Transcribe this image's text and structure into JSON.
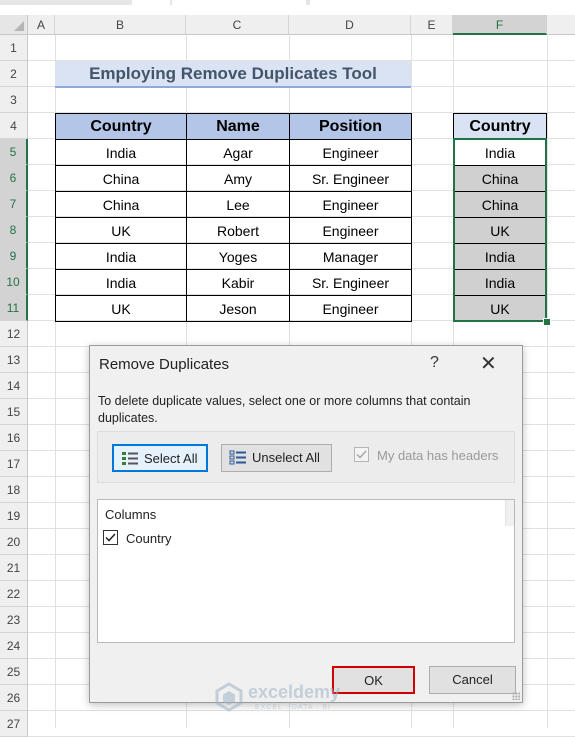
{
  "columns": [
    "A",
    "B",
    "C",
    "D",
    "E",
    "F"
  ],
  "rows": [
    "1",
    "2",
    "3",
    "4",
    "5",
    "6",
    "7",
    "8",
    "9",
    "10",
    "11",
    "12",
    "13",
    "14",
    "15",
    "16",
    "17",
    "18",
    "19",
    "20",
    "21",
    "22",
    "23",
    "24",
    "25",
    "26",
    "27"
  ],
  "sheet_title": "Employing Remove Duplicates Tool",
  "table": {
    "headers": [
      "Country",
      "Name",
      "Position"
    ],
    "rows": [
      [
        "India",
        "Agar",
        "Engineer"
      ],
      [
        "China",
        "Amy",
        "Sr. Engineer"
      ],
      [
        "China",
        "Lee",
        "Engineer"
      ],
      [
        "UK",
        "Robert",
        "Engineer"
      ],
      [
        "India",
        "Yoges",
        "Manager"
      ],
      [
        "India",
        "Kabir",
        "Sr. Engineer"
      ],
      [
        "UK",
        "Jeson",
        "Engineer"
      ]
    ]
  },
  "country_column": {
    "header": "Country",
    "values": [
      "India",
      "China",
      "China",
      "UK",
      "India",
      "India",
      "UK"
    ]
  },
  "dialog": {
    "title": "Remove Duplicates",
    "help": "?",
    "close": "✕",
    "message": "To delete duplicate values, select one or more columns that contain duplicates.",
    "select_all": "Select All",
    "unselect_all": "Unselect All",
    "has_headers": "My data has headers",
    "columns_header": "Columns",
    "column_item": "Country",
    "ok": "OK",
    "cancel": "Cancel"
  },
  "watermark": {
    "name": "exceldemy",
    "sub": "EXCEL · DATA · BI"
  },
  "colors": {
    "accent_green": "#217346",
    "header_blue": "#b4c6e7",
    "ok_highlight": "#d00000",
    "focus_blue": "#0078d7"
  }
}
